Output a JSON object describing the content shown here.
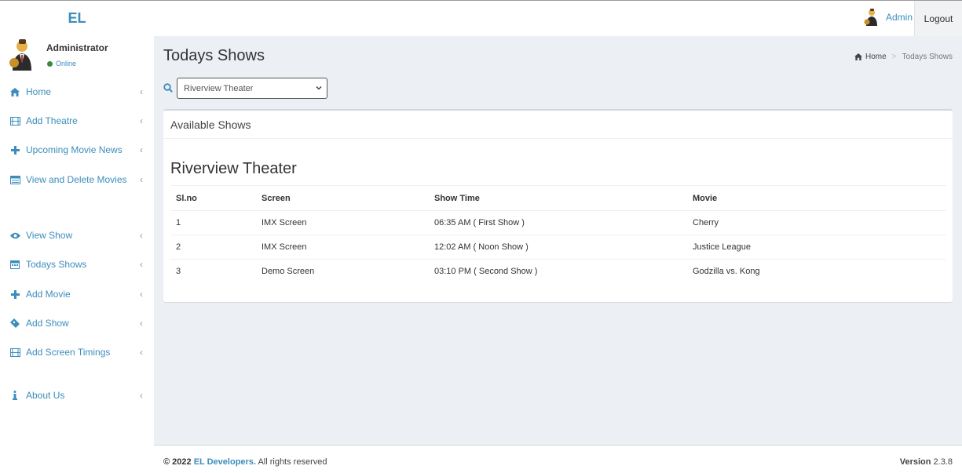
{
  "brand": "EL",
  "user": {
    "name": "Administrator",
    "status": "Online",
    "status_color": "#3a8a3a"
  },
  "sidebar": {
    "items": [
      {
        "label": "Home",
        "icon": "home-icon"
      },
      {
        "label": "Add Theatre",
        "icon": "film-icon"
      },
      {
        "label": "Upcoming Movie News",
        "icon": "plus-icon"
      },
      {
        "label": "View and Delete Movies",
        "icon": "list-icon"
      },
      {
        "label": "View Show",
        "icon": "eye-icon"
      },
      {
        "label": "Todays Shows",
        "icon": "calendar-icon"
      },
      {
        "label": "Add Movie",
        "icon": "plus-icon"
      },
      {
        "label": "Add Show",
        "icon": "ticket-icon"
      },
      {
        "label": "Add Screen Timings",
        "icon": "film-icon"
      },
      {
        "label": "About Us",
        "icon": "info-icon"
      }
    ]
  },
  "header": {
    "admin_label": "Admin",
    "logout_label": "Logout"
  },
  "page": {
    "title": "Todays Shows",
    "breadcrumb": {
      "home": "Home",
      "current": "Todays Shows"
    },
    "theater_select": {
      "value": "Riverview Theater"
    },
    "box_title": "Available Shows",
    "theater_heading": "Riverview Theater",
    "table": {
      "headers": [
        "Sl.no",
        "Screen",
        "Show Time",
        "Movie"
      ],
      "rows": [
        [
          "1",
          "IMX Screen",
          "06:35 AM ( First Show )",
          "Cherry"
        ],
        [
          "2",
          "IMX Screen",
          "12:02 AM ( Noon Show )",
          "Justice League"
        ],
        [
          "3",
          "Demo Screen",
          "03:10 PM ( Second Show )",
          "Godzilla vs. Kong"
        ]
      ]
    }
  },
  "footer": {
    "copy_prefix": "© 2022",
    "company": "EL Developers.",
    "rights": "All rights reserved",
    "version_label": "Version",
    "version": "2.3.8"
  },
  "colors": {
    "accent": "#3c8dbc",
    "content_bg": "#ecf0f5"
  }
}
